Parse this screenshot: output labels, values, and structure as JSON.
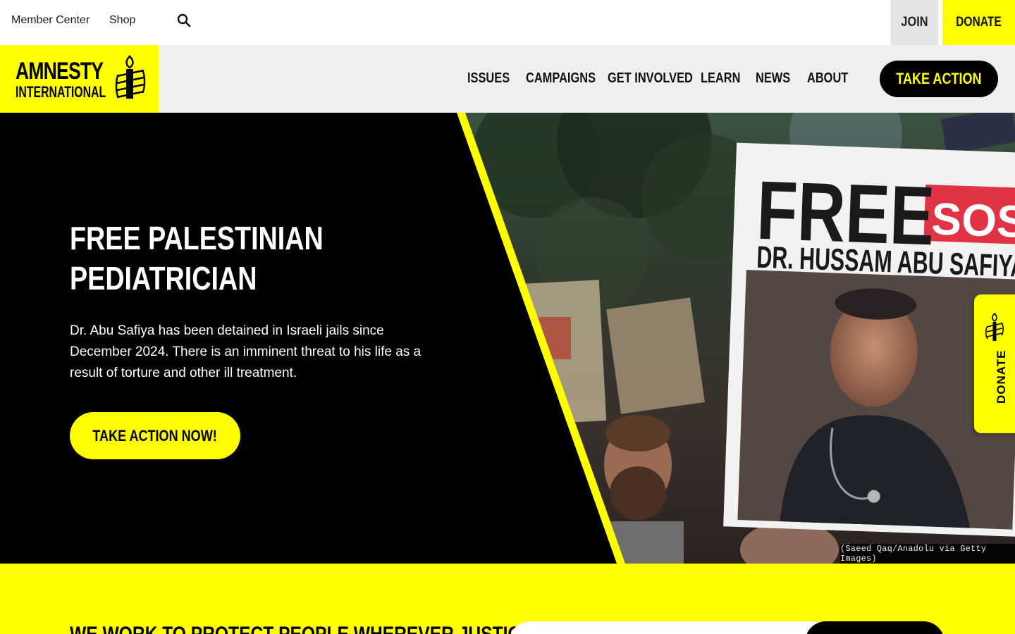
{
  "utility": {
    "member_center": "Member Center",
    "shop": "Shop",
    "join": "JOIN",
    "donate": "DONATE"
  },
  "logo": {
    "line1": "AMNESTY",
    "line2": "INTERNATIONAL"
  },
  "nav": {
    "items": [
      "ISSUES",
      "CAMPAIGNS",
      "GET INVOLVED",
      "LEARN",
      "NEWS",
      "ABOUT"
    ],
    "take_action": "TAKE ACTION"
  },
  "hero": {
    "title_line1": "FREE PALESTINIAN",
    "title_line2": "PEDIATRICIAN",
    "body": "Dr. Abu Safiya has been detained in Israeli jails since December 2024. There is an imminent threat to his life as a result of torture and other ill treatment.",
    "cta": "TAKE ACTION NOW!",
    "photo_credit": "(Saeed Qaq/Anadolu via Getty Images)",
    "placard": {
      "free": "FREE",
      "sos": "SOS",
      "name": "DR. HUSSAM ABU SAFIYA"
    }
  },
  "donate_tab": {
    "label": "DONATE"
  },
  "band": {
    "heading": "WE WORK TO PROTECT PEOPLE WHEREVER JUSTICE"
  },
  "colors": {
    "brand_yellow": "#ffff00",
    "black": "#000000",
    "header_gray": "#efefef",
    "join_gray": "#e4e4e4"
  }
}
